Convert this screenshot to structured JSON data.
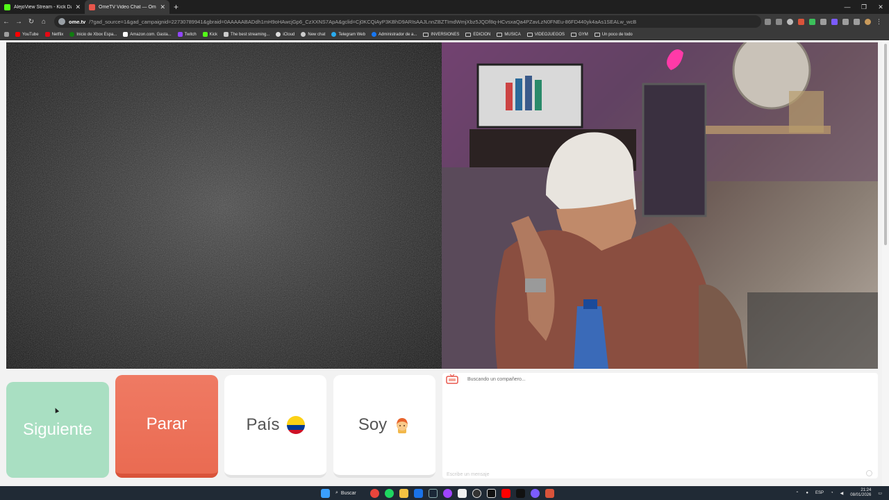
{
  "browser": {
    "tabs": [
      {
        "title": "AlejoView Stream - Kick Dashb",
        "favicon_color": "#53fc18",
        "active": false
      },
      {
        "title": "OmeTV Video Chat — Ome",
        "favicon_color": "#e8564b",
        "active": true
      }
    ],
    "address": {
      "host": "ome.tv",
      "path": "/?gad_source=1&gad_campaignid=22730789941&gbraid=0AAAAABADdh1mH9oHAwcjGp6_CzXXNS7ApA&gclid=Cj0KCQiAyP3KBhD9ARIsAAJLnnZBZTImdWmjXbz5JQDf8q-HCvsxaQa4PZavLzN0FNEu-86FD440yk4aAs1SEALw_wcB"
    },
    "bookmarks": [
      {
        "label": "YouTube",
        "color": "#ff0000"
      },
      {
        "label": "Netflix",
        "color": "#e50914"
      },
      {
        "label": "Inicio de Xbox Espa...",
        "color": "#107c10"
      },
      {
        "label": "Amazon.com. Gasta...",
        "color": "#ffffff"
      },
      {
        "label": "Twitch",
        "color": "#9146ff"
      },
      {
        "label": "Kick",
        "color": "#53fc18"
      },
      {
        "label": "The best streaming...",
        "color": "#cccccc"
      },
      {
        "label": "iCloud",
        "color": "#dddddd"
      },
      {
        "label": "New chat",
        "color": "#cccccc"
      },
      {
        "label": "Telegram Web",
        "color": "#2aabee"
      },
      {
        "label": "Administrador de a...",
        "color": "#1877f2"
      },
      {
        "label": "INVERSIONES",
        "folder": true
      },
      {
        "label": "EDICION",
        "folder": true
      },
      {
        "label": "MUSICA",
        "folder": true
      },
      {
        "label": "VIDEOJUEGOS",
        "folder": true
      },
      {
        "label": "GYM",
        "folder": true
      },
      {
        "label": "Un poco de todo",
        "folder": true
      }
    ]
  },
  "controls": {
    "next_label": "Siguiente",
    "stop_label": "Parar",
    "country_label": "País",
    "gender_label": "Soy"
  },
  "chat": {
    "status": "Buscando un compañero...",
    "input_placeholder": "Escribe un mensaje"
  },
  "taskbar": {
    "search_label": "Buscar",
    "language": "ESP",
    "time": "21:24",
    "date": "08/01/2026"
  },
  "colors": {
    "next_button": "#a9dfc2",
    "stop_button": "#ea6b52"
  }
}
